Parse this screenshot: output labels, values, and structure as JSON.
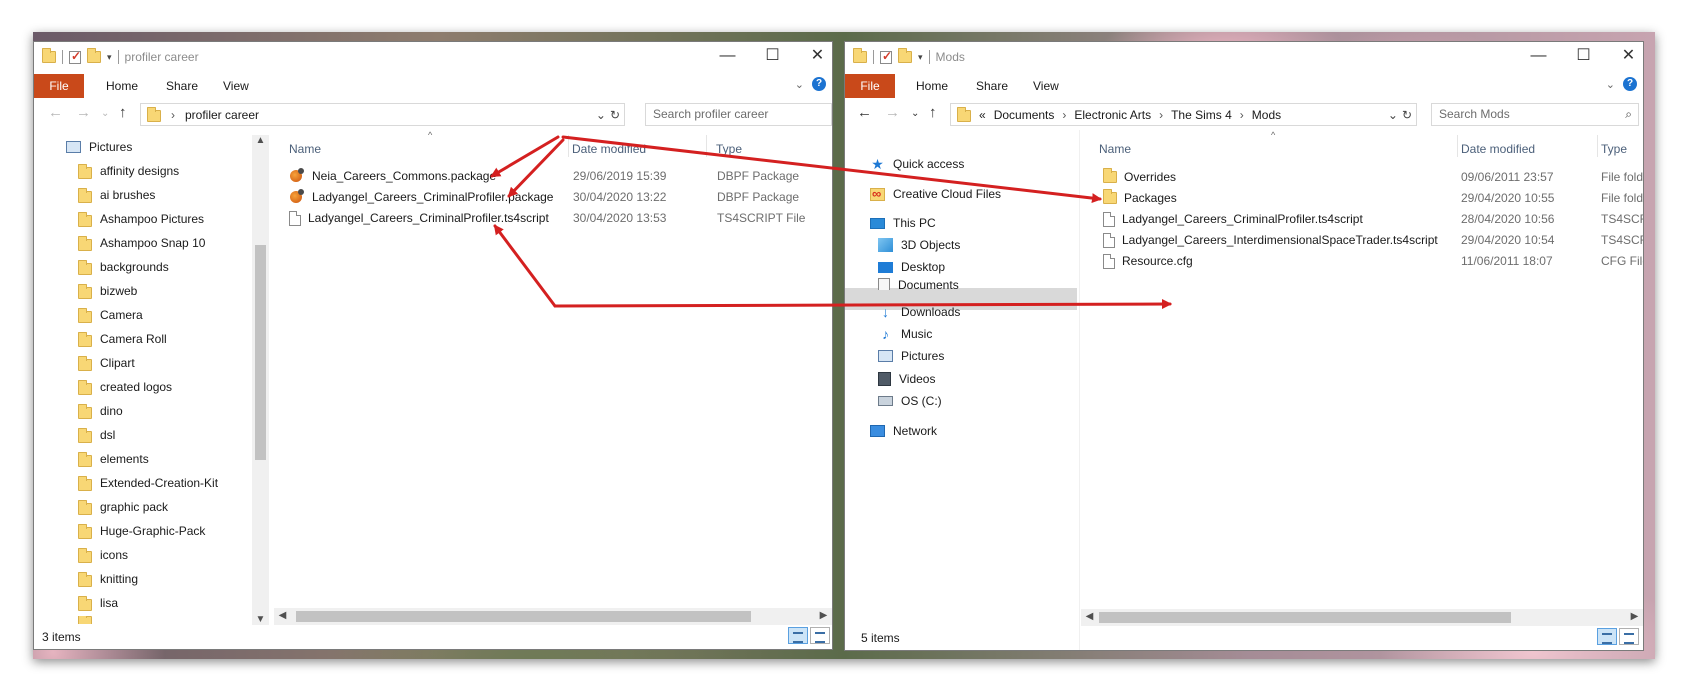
{
  "left_window": {
    "title": "profiler career",
    "ribbon": {
      "file": "File",
      "home": "Home",
      "share": "Share",
      "view": "View",
      "help": "?"
    },
    "window_buttons": {
      "minimize": "—",
      "maximize": "☐",
      "close": "✕"
    },
    "address": {
      "crumb": "profiler career"
    },
    "search_placeholder": "Search profiler career",
    "nav_items": [
      "Pictures",
      "affinity designs",
      "ai brushes",
      "Ashampoo Pictures",
      "Ashampoo Snap 10",
      "backgrounds",
      "bizweb",
      "Camera",
      "Camera Roll",
      "Clipart",
      "created logos",
      "dino",
      "dsl",
      "elements",
      "Extended-Creation-Kit",
      "graphic pack",
      "Huge-Graphic-Pack",
      "icons",
      "knitting",
      "lisa"
    ],
    "columns": {
      "name": "Name",
      "date": "Date modified",
      "type": "Type"
    },
    "files": [
      {
        "name": "Neia_Careers_Commons.package",
        "date": "29/06/2019 15:39",
        "type": "DBPF Package",
        "icon": "package-icon"
      },
      {
        "name": "Ladyangel_Careers_CriminalProfiler.package",
        "date": "30/04/2020 13:22",
        "type": "DBPF Package",
        "icon": "package-icon"
      },
      {
        "name": "Ladyangel_Careers_CriminalProfiler.ts4script",
        "date": "30/04/2020 13:53",
        "type": "TS4SCRIPT File",
        "icon": "file-icon"
      }
    ],
    "status": "3 items"
  },
  "right_window": {
    "title": "Mods",
    "ribbon": {
      "file": "File",
      "home": "Home",
      "share": "Share",
      "view": "View",
      "help": "?"
    },
    "window_buttons": {
      "minimize": "—",
      "maximize": "☐",
      "close": "✕"
    },
    "address": {
      "overflow": "«",
      "crumbs": [
        "Documents",
        "Electronic Arts",
        "The Sims 4",
        "Mods"
      ]
    },
    "search_placeholder": "Search Mods",
    "nav_items": {
      "quick_access": "Quick access",
      "creative_cloud": "Creative Cloud Files",
      "this_pc": "This PC",
      "objects3d": "3D Objects",
      "desktop": "Desktop",
      "documents": "Documents",
      "downloads": "Downloads",
      "music": "Music",
      "pictures": "Pictures",
      "videos": "Videos",
      "os_drive": "OS (C:)",
      "network": "Network"
    },
    "columns": {
      "name": "Name",
      "date": "Date modified",
      "type": "Type"
    },
    "files": [
      {
        "name": "Overrides",
        "date": "09/06/2011 23:57",
        "type": "File fold",
        "icon": "folder-icon"
      },
      {
        "name": "Packages",
        "date": "29/04/2020 10:55",
        "type": "File fold",
        "icon": "folder-icon"
      },
      {
        "name": "Ladyangel_Careers_CriminalProfiler.ts4script",
        "date": "28/04/2020 10:56",
        "type": "TS4SCR",
        "icon": "file-icon"
      },
      {
        "name": "Ladyangel_Careers_InterdimensionalSpaceTrader.ts4script",
        "date": "29/04/2020 10:54",
        "type": "TS4SCR",
        "icon": "file-icon"
      },
      {
        "name": "Resource.cfg",
        "date": "11/06/2011 18:07",
        "type": "CFG File",
        "icon": "file-icon"
      }
    ],
    "status": "5 items"
  },
  "annotation_color": "#d42020"
}
